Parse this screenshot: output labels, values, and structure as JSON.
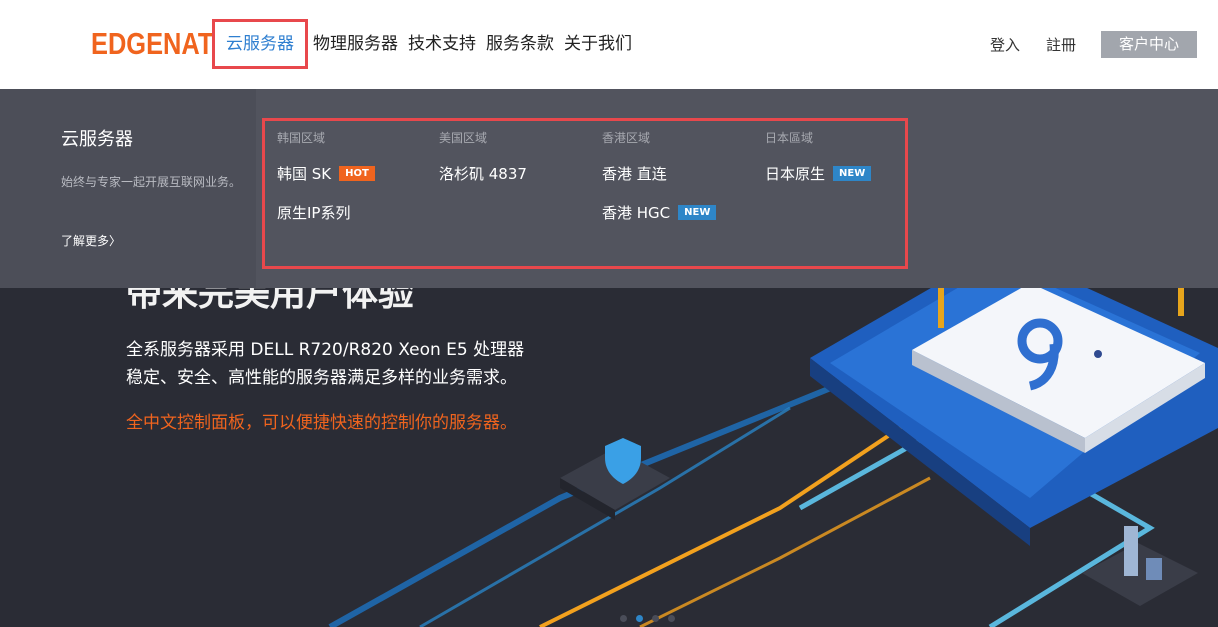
{
  "header": {
    "logo": "EDGENAT",
    "nav": [
      {
        "label": "云服务器",
        "active": true
      },
      {
        "label": "物理服务器"
      },
      {
        "label": "技术支持"
      },
      {
        "label": "服务条款"
      },
      {
        "label": "关于我们"
      }
    ],
    "login": "登入",
    "register": "註冊",
    "client_center": "客户中心"
  },
  "dropdown": {
    "side_title": "云服务器",
    "side_desc": "始终与专家一起开展互联网业务。",
    "side_more": "了解更多〉",
    "columns": [
      {
        "title": "韩国区域",
        "links": [
          {
            "label": "韩国 SK",
            "badge": "HOT"
          },
          {
            "label": "原生IP系列"
          }
        ]
      },
      {
        "title": "美国区域",
        "links": [
          {
            "label": "洛杉矶 4837"
          }
        ]
      },
      {
        "title": "香港区域",
        "links": [
          {
            "label": "香港 直连"
          },
          {
            "label": "香港 HGC",
            "badge": "NEW"
          }
        ]
      },
      {
        "title": "日本區域",
        "links": [
          {
            "label": "日本原生",
            "badge": "NEW"
          }
        ]
      }
    ]
  },
  "hero": {
    "title": "带来完美用户体验",
    "line1": "全系服务器采用 DELL R720/R820 Xeon E5 处理器",
    "line2": "稳定、安全、高性能的服务器满足多样的业务需求。",
    "highlight": "全中文控制面板，可以便捷快速的控制你的服务器。",
    "slides": 4,
    "active_slide": 2
  },
  "colors": {
    "brand": "#f0641e",
    "link_active": "#2f7fd0",
    "highlight_box": "#e8484c",
    "dropdown_bg": "#52545e",
    "hot_badge": "#f0641e",
    "new_badge": "#2e86c8"
  }
}
